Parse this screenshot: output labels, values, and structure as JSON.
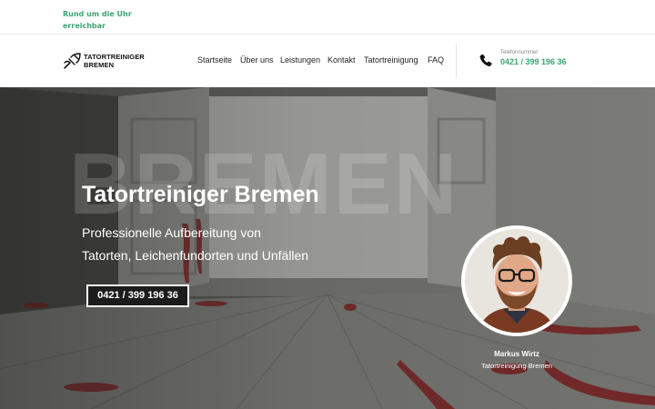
{
  "topbar": {
    "availability": "Rund um die Uhr erreichbar"
  },
  "header": {
    "logo": {
      "line1": "TATORTREINIGER",
      "line2": "BREMEN",
      "icon": "brush-logo-icon"
    },
    "nav": [
      {
        "label": "Startseite"
      },
      {
        "label": "Über uns"
      },
      {
        "label": "Leistungen"
      },
      {
        "label": "Kontakt"
      },
      {
        "label": "Tatortreinigung"
      },
      {
        "label": "FAQ"
      }
    ],
    "phone": {
      "icon": "phone-icon",
      "label": "Telefonnummer",
      "number": "0421 / 399 196 36"
    }
  },
  "hero": {
    "bg_word": "BREMEN",
    "title": "Tatortreiniger Bremen",
    "subtitle_line1": "Professionelle Aufbereitung von",
    "subtitle_line2": "Tatorten, Leichenfundorten und Unfällen",
    "cta_label": "0421 / 399 196 36",
    "person": {
      "name": "Markus Wirtz",
      "role": "Tatortreinigung Bremen"
    }
  },
  "colors": {
    "accent": "#3aa672",
    "cta_bg": "#1c1c1c",
    "text_dark": "#222222"
  }
}
